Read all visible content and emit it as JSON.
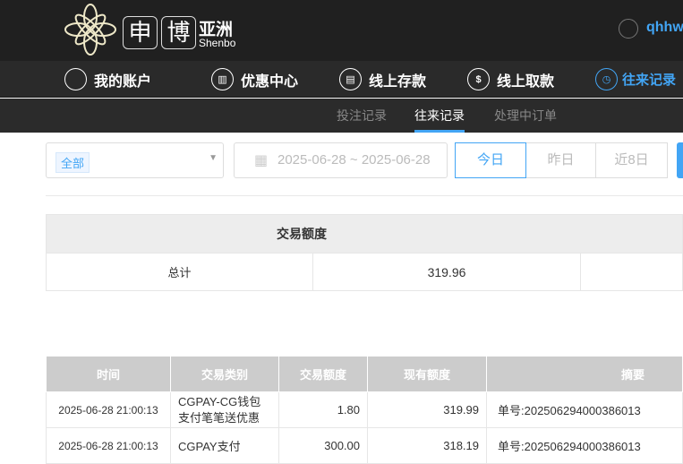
{
  "header": {
    "logo_chars": [
      "申",
      "博"
    ],
    "logo_cn": "亚洲",
    "logo_en": "Shenbo",
    "username": "qhhw"
  },
  "nav": [
    {
      "label": "我的账户",
      "icon": "user-icon"
    },
    {
      "label": "优惠中心",
      "icon": "gift-icon"
    },
    {
      "label": "线上存款",
      "icon": "deposit-icon"
    },
    {
      "label": "线上取款",
      "icon": "withdraw-icon"
    },
    {
      "label": "往来记录",
      "icon": "records-icon",
      "active": true
    }
  ],
  "subnav": [
    {
      "label": "投注记录"
    },
    {
      "label": "往来记录",
      "active": true
    },
    {
      "label": "处理中订单"
    }
  ],
  "filter": {
    "type_tag": "全部",
    "date_range": "2025-06-28 ~ 2025-06-28",
    "buttons": [
      "今日",
      "昨日",
      "近8日"
    ]
  },
  "summary": {
    "header": "交易额度",
    "row_label": "总计",
    "total": "319.96"
  },
  "table": {
    "columns": [
      "时间",
      "交易类别",
      "交易额度",
      "现有额度",
      "摘要"
    ],
    "rows": [
      {
        "time": "2025-06-28 21:00:13",
        "type": "CGPAY-CG钱包支付笔笔送优惠",
        "amount": "1.80",
        "balance": "319.99",
        "memo": "单号:202506294000386013"
      },
      {
        "time": "2025-06-28 21:00:13",
        "type": "CGPAY支付",
        "amount": "300.00",
        "balance": "318.19",
        "memo": "单号:202506294000386013"
      }
    ]
  },
  "colors": {
    "accent": "#42a5f5",
    "header_bg": "#202020",
    "table_header_bg": "#cccccc"
  }
}
